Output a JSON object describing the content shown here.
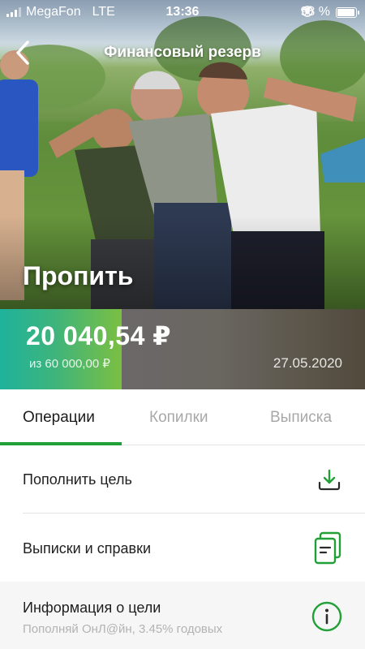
{
  "status_bar": {
    "carrier": "MegaFon",
    "network": "LTE",
    "time": "13:36",
    "battery": "98 %"
  },
  "nav": {
    "title": "Финансовый резерв",
    "back_icon": "chevron-left-icon"
  },
  "goal": {
    "name": "Пропить",
    "amount": "20 040,54 ₽",
    "target": "из 60 000,00 ₽",
    "date": "27.05.2020",
    "progress_fraction": 0.334
  },
  "tabs": [
    {
      "label": "Операции",
      "active": true
    },
    {
      "label": "Копилки",
      "active": false
    },
    {
      "label": "Выписка",
      "active": false
    }
  ],
  "actions": {
    "top_up": {
      "label": "Пополнить цель",
      "icon": "download-tray-icon"
    },
    "statements": {
      "label": "Выписки и справки",
      "icon": "documents-icon"
    },
    "goal_info": {
      "label": "Информация о цели",
      "sub": "Пополняй ОнЛ@йн, 3.45% годовых",
      "icon": "info-circle-icon"
    }
  },
  "colors": {
    "accent": "#21a038",
    "progress_start": "#1fb29c",
    "progress_end": "#7bbf42"
  }
}
